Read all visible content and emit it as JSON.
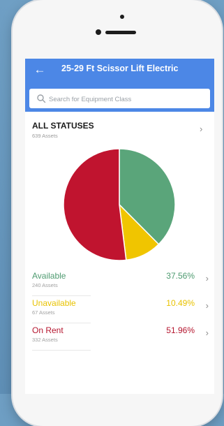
{
  "app_bar": {
    "title": "25-29 Ft Scissor Lift Electric",
    "back_icon": "arrow-left-icon"
  },
  "search": {
    "placeholder": "Search for Equipment Class",
    "value": ""
  },
  "summary": {
    "title": "ALL STATUSES",
    "subtitle": "639 Assets"
  },
  "statuses": [
    {
      "label": "Available",
      "subtitle": "240 Assets",
      "percent": "37.56%",
      "value": 37.56,
      "color": "#5aa57a"
    },
    {
      "label": "Unavailable",
      "subtitle": "67 Assets",
      "percent": "10.49%",
      "value": 10.49,
      "color": "#f0c500"
    },
    {
      "label": "On Rent",
      "subtitle": "332 Assets",
      "percent": "51.96%",
      "value": 51.96,
      "color": "#c0142f"
    }
  ]
}
